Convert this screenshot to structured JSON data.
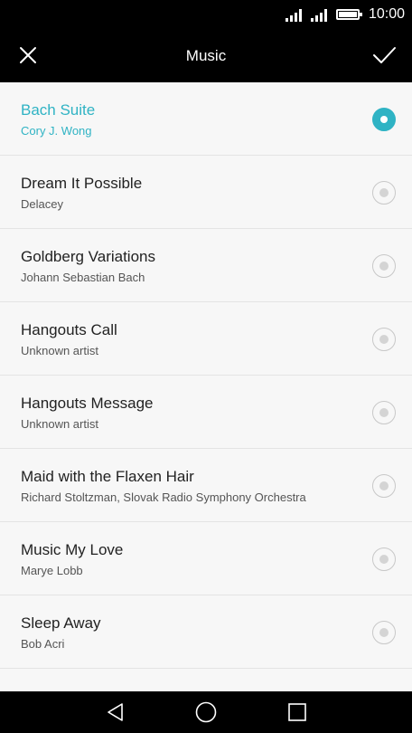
{
  "status": {
    "time": "10:00"
  },
  "header": {
    "title": "Music"
  },
  "songs": [
    {
      "title": "Bach Suite",
      "artist": "Cory J. Wong",
      "selected": true
    },
    {
      "title": "Dream It Possible",
      "artist": "Delacey",
      "selected": false
    },
    {
      "title": "Goldberg Variations",
      "artist": "Johann Sebastian Bach",
      "selected": false
    },
    {
      "title": "Hangouts Call",
      "artist": "Unknown artist",
      "selected": false
    },
    {
      "title": "Hangouts Message",
      "artist": "Unknown artist",
      "selected": false
    },
    {
      "title": "Maid with the Flaxen Hair",
      "artist": "Richard Stoltzman, Slovak Radio Symphony Orchestra",
      "selected": false
    },
    {
      "title": "Music My Love",
      "artist": "Marye Lobb",
      "selected": false
    },
    {
      "title": "Sleep Away",
      "artist": "Bob Acri",
      "selected": false
    }
  ],
  "colors": {
    "accent": "#2fb3c4",
    "bar_background": "#000000",
    "list_background": "#f7f7f7"
  },
  "icons": {
    "close": "close-icon",
    "confirm": "check-icon",
    "back": "back-triangle-icon",
    "home": "home-circle-icon",
    "recent": "recent-square-icon"
  }
}
